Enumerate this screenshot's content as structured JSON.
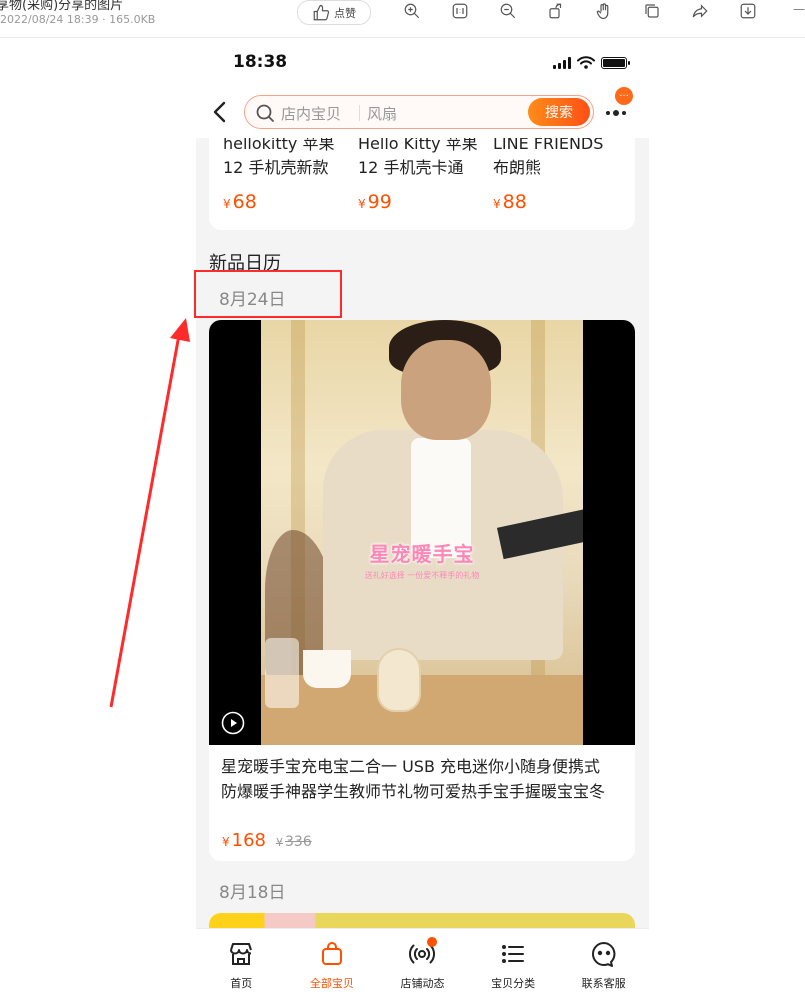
{
  "viewer": {
    "title": "享物(采购)分享的图片",
    "meta": "2022/08/24 18:39 · 165.0KB",
    "like_label": "点赞",
    "edge_mark": "—",
    "tools": [
      "zoom-in-icon",
      "actual-size-icon",
      "zoom-out-icon",
      "rotate-icon",
      "hand-icon",
      "copy-icon",
      "share-icon",
      "download-icon"
    ]
  },
  "status_bar": {
    "time": "18:38"
  },
  "search": {
    "placeholder_main": "店内宝贝",
    "placeholder_hint": "风扇",
    "button": "搜索",
    "badge": "···"
  },
  "strip_products": [
    {
      "title_line1": "hellokitty 苹果",
      "title_line2": "12 手机壳新款",
      "price": "68"
    },
    {
      "title_line1": "Hello Kitty 苹果",
      "title_line2": "12 手机壳卡通",
      "price": "99"
    },
    {
      "title_line1": "LINE FRIENDS",
      "title_line2": "布朗熊",
      "price": "88"
    }
  ],
  "currency": "¥",
  "section": {
    "title": "新品日历",
    "date_1": "8月24日",
    "date_2": "8月18日"
  },
  "video_product": {
    "overlay_title": "星宠暖手宝",
    "overlay_subtitle": "送礼好选择 一份爱不释手的礼物",
    "desc_line1": "星宠暖手宝充电宝二合一 USB 充电迷你小随身便携式",
    "desc_line2": "防爆暖手神器学生教师节礼物可爱热手宝手握暖宝宝冬",
    "price": "168",
    "original_price": "336"
  },
  "tabs": [
    {
      "label": "首页",
      "icon": "store-icon",
      "active": false
    },
    {
      "label": "全部宝贝",
      "icon": "bag-icon",
      "active": true
    },
    {
      "label": "店铺动态",
      "icon": "broadcast-icon",
      "active": false,
      "dot": true
    },
    {
      "label": "宝贝分类",
      "icon": "list-icon",
      "active": false
    },
    {
      "label": "联系客服",
      "icon": "service-icon",
      "active": false
    }
  ],
  "colors": {
    "accent": "#ff5000",
    "annotation": "#ff2a2a"
  }
}
